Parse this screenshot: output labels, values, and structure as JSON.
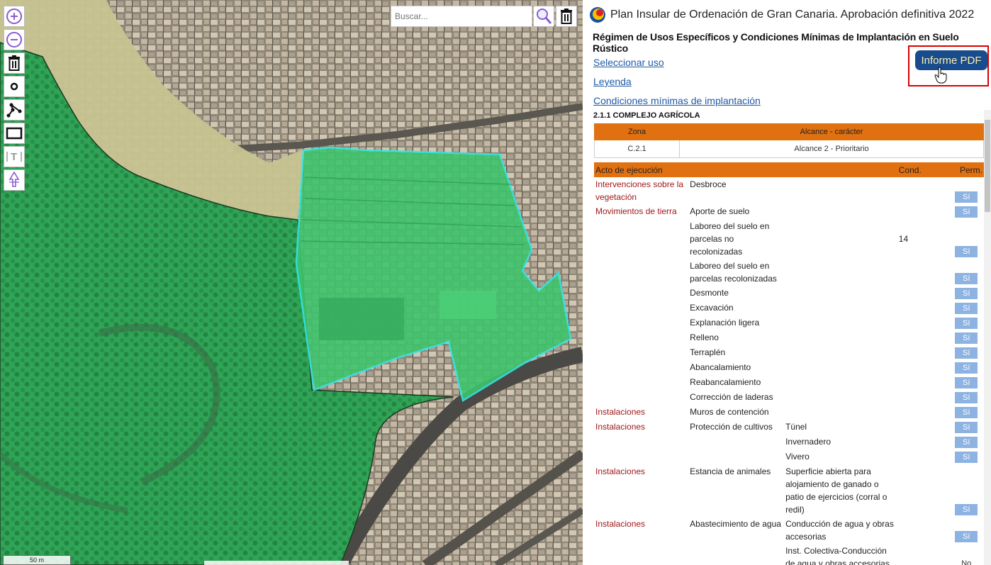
{
  "map": {
    "search_placeholder": "Buscar...",
    "scale_label": "50 m",
    "coords": "",
    "toolbar": [
      "zoom-in-icon",
      "zoom-out-icon",
      "trash-icon",
      "point-icon",
      "polyline-icon",
      "rectangle-icon",
      "text-icon",
      "select-icon"
    ]
  },
  "panel": {
    "title": "Plan Insular de Ordenación de Gran Canaria. Aprobación definitiva 2022",
    "subtitle": "Régimen de Usos Específicos y Condiciones Mínimas de Implantación en Suelo Rústico",
    "links": {
      "seleccionar": "Seleccionar uso",
      "leyenda": "Leyenda",
      "condiciones": "Condiciones mínimas de implantación"
    },
    "pdf_button": "Informe PDF",
    "section": "2.1.1 COMPLEJO AGRÍCOLA",
    "zone_table": {
      "headers": [
        "Zona",
        "Alcance - carácter"
      ],
      "row": [
        "C.2.1",
        "Alcance 2 - Prioritario"
      ]
    },
    "acts_table": {
      "headers": [
        "Acto de ejecución",
        "",
        "",
        "Cond.",
        "Perm."
      ],
      "rows": [
        {
          "cat": "Intervenciones sobre la vegetación",
          "act": "Desbroce",
          "sub": "",
          "cond": "",
          "perm": "Sí"
        },
        {
          "cat": "Movimientos de tierra",
          "act": "Aporte de suelo",
          "sub": "",
          "cond": "",
          "perm": "Sí"
        },
        {
          "cat": "",
          "act": "Laboreo del suelo en parcelas no recolonizadas",
          "sub": "",
          "cond": "14",
          "perm": "Sí"
        },
        {
          "cat": "",
          "act": "Laboreo del suelo en parcelas recolonizadas",
          "sub": "",
          "cond": "",
          "perm": "Sí"
        },
        {
          "cat": "",
          "act": "Desmonte",
          "sub": "",
          "cond": "",
          "perm": "Sí"
        },
        {
          "cat": "",
          "act": "Excavación",
          "sub": "",
          "cond": "",
          "perm": "Sí"
        },
        {
          "cat": "",
          "act": "Explanación ligera",
          "sub": "",
          "cond": "",
          "perm": "Sí"
        },
        {
          "cat": "",
          "act": "Relleno",
          "sub": "",
          "cond": "",
          "perm": "Sí"
        },
        {
          "cat": "",
          "act": "Terraplén",
          "sub": "",
          "cond": "",
          "perm": "Sí"
        },
        {
          "cat": "",
          "act": "Abancalamiento",
          "sub": "",
          "cond": "",
          "perm": "Sí"
        },
        {
          "cat": "",
          "act": "Reabancalamiento",
          "sub": "",
          "cond": "",
          "perm": "Sí"
        },
        {
          "cat": "",
          "act": "Corrección de laderas",
          "sub": "",
          "cond": "",
          "perm": "Sí"
        },
        {
          "cat": "Instalaciones",
          "act": "Muros de contención",
          "sub": "",
          "cond": "",
          "perm": "Sí"
        },
        {
          "cat": "Instalaciones",
          "act": "Protección de cultivos",
          "sub": "Túnel",
          "cond": "",
          "perm": "Sí"
        },
        {
          "cat": "",
          "act": "",
          "sub": "Invernadero",
          "cond": "",
          "perm": "Sí"
        },
        {
          "cat": "",
          "act": "",
          "sub": "Vivero",
          "cond": "",
          "perm": "Sí"
        },
        {
          "cat": "Instalaciones",
          "act": "Estancia de animales",
          "sub": "Superficie abierta para alojamiento de ganado o patio de ejercicios (corral o redil)",
          "cond": "",
          "perm": "Sí"
        },
        {
          "cat": "Instalaciones",
          "act": "Abastecimiento de agua",
          "sub": "Conducción de agua y obras accesorias",
          "cond": "",
          "perm": "Sí"
        },
        {
          "cat": "",
          "act": "",
          "sub": "Inst. Colectiva-Conducción de agua y obras accesorias",
          "cond": "",
          "perm": "No"
        }
      ]
    }
  },
  "colors": {
    "orange_header": "#e07010",
    "category_red": "#a0191b",
    "link_blue": "#1f5aa6",
    "pdf_button_bg": "#184c8c",
    "permit_badge": "#8db3e2",
    "highlight_border": "#d90000",
    "zone_green": "#2db35a",
    "parcel_outline": "#33e5e5"
  }
}
